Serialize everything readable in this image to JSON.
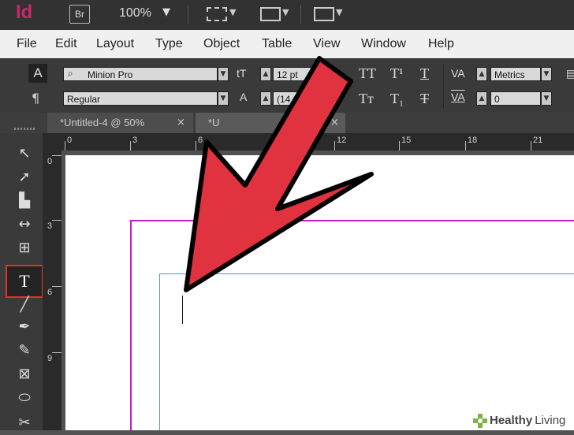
{
  "app": {
    "logo": "Id",
    "bridge_label": "Br",
    "zoom": "100%"
  },
  "menu": {
    "items": [
      "File",
      "Edit",
      "Layout",
      "Type",
      "Object",
      "Table",
      "View",
      "Window",
      "Help"
    ]
  },
  "control_panel": {
    "char_label": "A",
    "para_label": "¶",
    "font_family": "Minion Pro",
    "font_style": "Regular",
    "font_size": "12 pt",
    "leading": "(14",
    "kerning": "Metrics",
    "tracking": "0",
    "icons": {
      "all_caps": "TT",
      "superscript": "T¹",
      "underline": "T",
      "small_caps": "Tт",
      "subscript": "T₁",
      "strikethrough": "T",
      "kerning_icon": "VA",
      "tracking_icon": "VA"
    }
  },
  "tabs": [
    {
      "label": "*Untitled-4 @ 50%",
      "close": "×"
    },
    {
      "label": "*U",
      "close": "×"
    }
  ],
  "rulers": {
    "horizontal": [
      "0",
      "3",
      "6",
      "12",
      "15",
      "18",
      "21"
    ],
    "vertical": [
      "0",
      "3",
      "6",
      "9"
    ]
  },
  "toolbox": {
    "type_tool_label": "T"
  },
  "watermark": {
    "brand_bold": "Healthy",
    "brand_light": "Living"
  },
  "colors": {
    "arrow": "#e0323f",
    "margin_guide": "#c71dc2",
    "frame": "#5a8fd6",
    "logo": "#c7296c"
  }
}
